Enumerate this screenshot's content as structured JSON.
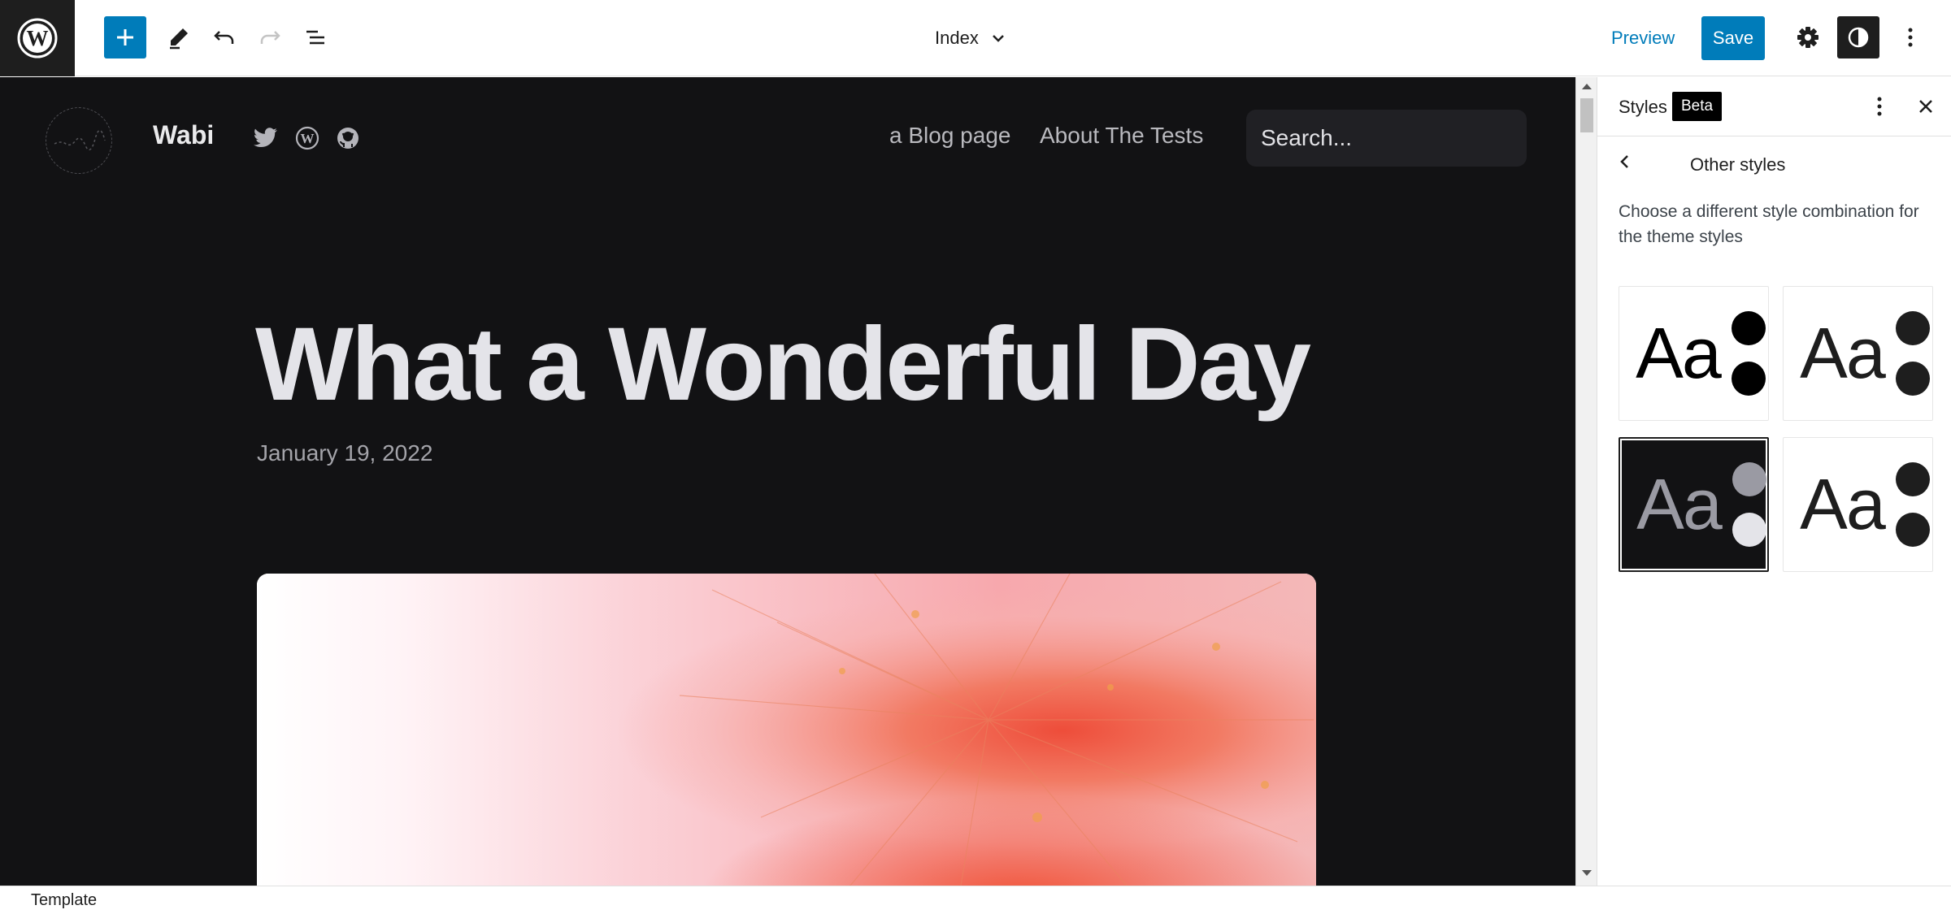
{
  "toolbar": {
    "template_name": "Index",
    "preview_label": "Preview",
    "save_label": "Save"
  },
  "site": {
    "title": "Wabi",
    "social_icons": [
      "twitter-icon",
      "wordpress-icon",
      "github-icon"
    ],
    "nav": [
      "a Blog page",
      "About The Tests"
    ],
    "search_placeholder": "Search..."
  },
  "post": {
    "title": "What a Wonderful Day",
    "date": "January 19, 2022"
  },
  "sidebar": {
    "title": "Styles",
    "badge": "Beta",
    "subtitle": "Other styles",
    "description": "Choose a different style combination for the theme styles",
    "variations": [
      {
        "text": "Aa",
        "bg": "#ffffff",
        "fg": "#000000",
        "dot1": "#000000",
        "dot2": "#000000",
        "selected": false
      },
      {
        "text": "Aa",
        "bg": "#ffffff",
        "fg": "#1e1e1e",
        "dot1": "#1e1e1e",
        "dot2": "#1e1e1e",
        "selected": false
      },
      {
        "text": "Aa",
        "bg": "#121214",
        "fg": "#9a9aa3",
        "dot1": "#9a9aa3",
        "dot2": "#e4e4e9",
        "selected": true
      },
      {
        "text": "Aa",
        "bg": "#ffffff",
        "fg": "#1e1e1e",
        "dot1": "#1e1e1e",
        "dot2": "#1e1e1e",
        "selected": false
      }
    ]
  },
  "footer": {
    "breadcrumb": "Template"
  },
  "colors": {
    "accent": "#007cba",
    "canvas_bg": "#121214",
    "topbar_dark": "#1e1e1e"
  }
}
